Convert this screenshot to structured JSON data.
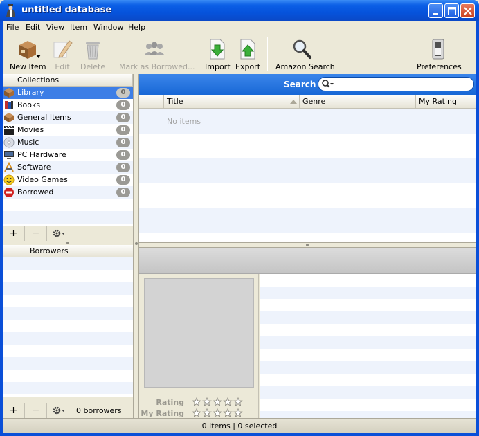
{
  "window": {
    "title": "untitled database",
    "colors": {
      "title_bar": "#0a4fd8",
      "selection": "#3d7ee6",
      "search_bar": "#1868d6"
    }
  },
  "menubar": [
    "File",
    "Edit",
    "View",
    "Item",
    "Window",
    "Help"
  ],
  "toolbar": {
    "new_item": "New Item",
    "edit": "Edit",
    "delete": "Delete",
    "mark_borrowed": "Mark as Borrowed...",
    "import": "Import",
    "export": "Export",
    "amazon_search": "Amazon Search",
    "preferences": "Preferences"
  },
  "collections": {
    "header": "Collections",
    "items": [
      {
        "label": "Library",
        "count": "0",
        "icon": "library-box-icon"
      },
      {
        "label": "Books",
        "count": "0",
        "icon": "book-icon"
      },
      {
        "label": "General Items",
        "count": "0",
        "icon": "box-icon"
      },
      {
        "label": "Movies",
        "count": "0",
        "icon": "clapperboard-icon"
      },
      {
        "label": "Music",
        "count": "0",
        "icon": "cd-icon"
      },
      {
        "label": "PC Hardware",
        "count": "0",
        "icon": "monitor-icon"
      },
      {
        "label": "Software",
        "count": "0",
        "icon": "software-icon"
      },
      {
        "label": "Video Games",
        "count": "0",
        "icon": "smiley-icon"
      },
      {
        "label": "Borrowed",
        "count": "0",
        "icon": "no-entry-icon"
      }
    ],
    "footer": {
      "add": "+",
      "remove": "−"
    }
  },
  "borrowers": {
    "header": "Borrowers",
    "footer": {
      "add": "+",
      "remove": "−",
      "count_text": "0 borrowers"
    }
  },
  "search": {
    "label": "Search",
    "value": ""
  },
  "table": {
    "columns": [
      "Title",
      "Genre",
      "My Rating"
    ],
    "empty_text": "No items"
  },
  "details": {
    "rating_label": "Rating",
    "my_rating_label": "My Rating",
    "rating_value": 0,
    "my_rating_value": 0
  },
  "statusbar": {
    "text": "0 items | 0 selected"
  }
}
